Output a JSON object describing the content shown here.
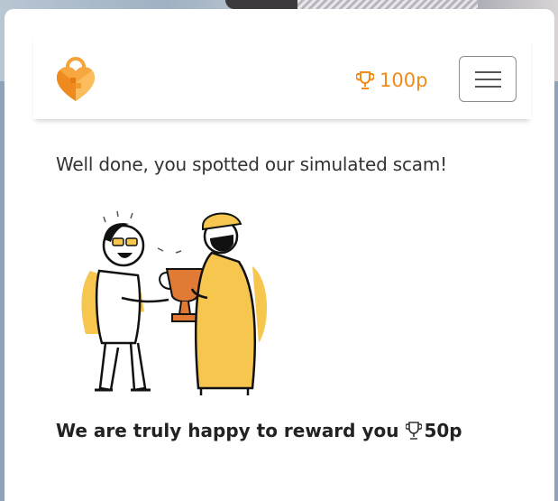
{
  "header": {
    "points_value": "100p",
    "logo_icon": "heart-lock-logo-icon",
    "trophy_icon": "trophy-icon",
    "menu_icon": "hamburger-menu-icon",
    "accent_color": "#f28a18"
  },
  "main": {
    "message": "Well done, you spotted our simulated scam!",
    "illustration": "two-people-trophy-illustration",
    "reward_text": "We are truly happy to reward you",
    "reward_points": "50p"
  }
}
